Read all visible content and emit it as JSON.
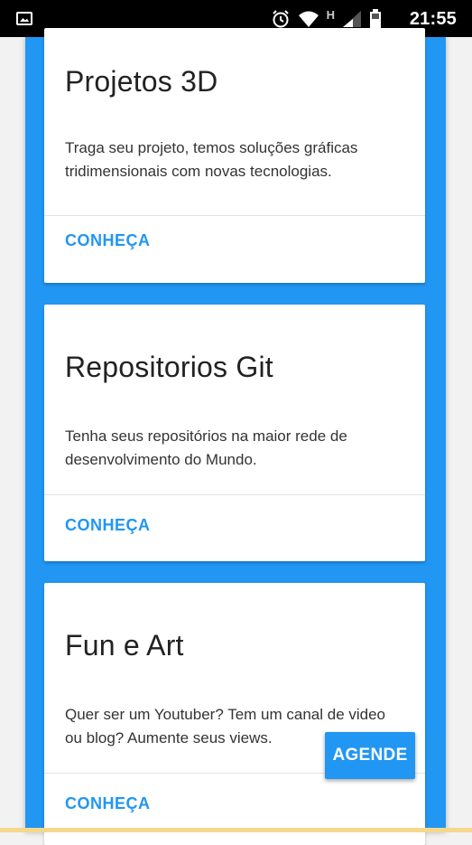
{
  "status_bar": {
    "time": "21:55",
    "network_label": "H",
    "icons": [
      "image-icon",
      "alarm-icon",
      "wifi-icon",
      "signal-icon",
      "battery-icon"
    ]
  },
  "colors": {
    "accent": "#2196F3",
    "frame": "#2196F3",
    "card": "#FFFFFF"
  },
  "cards": [
    {
      "title": "Projetos 3D",
      "description": "Traga seu projeto, temos soluções gráficas tridimensionais com novas tecnologias.",
      "action": "CONHEÇA"
    },
    {
      "title": "Repositorios Git",
      "description": "Tenha seus repositórios na maior rede de desenvolvimento do Mundo.",
      "action": "CONHEÇA"
    },
    {
      "title": "Fun e Art",
      "description": "Quer ser um Youtuber? Tem um canal de video ou blog? Aumente seus views.",
      "action": "CONHEÇA"
    }
  ],
  "fab": {
    "label": "AGENDE"
  }
}
